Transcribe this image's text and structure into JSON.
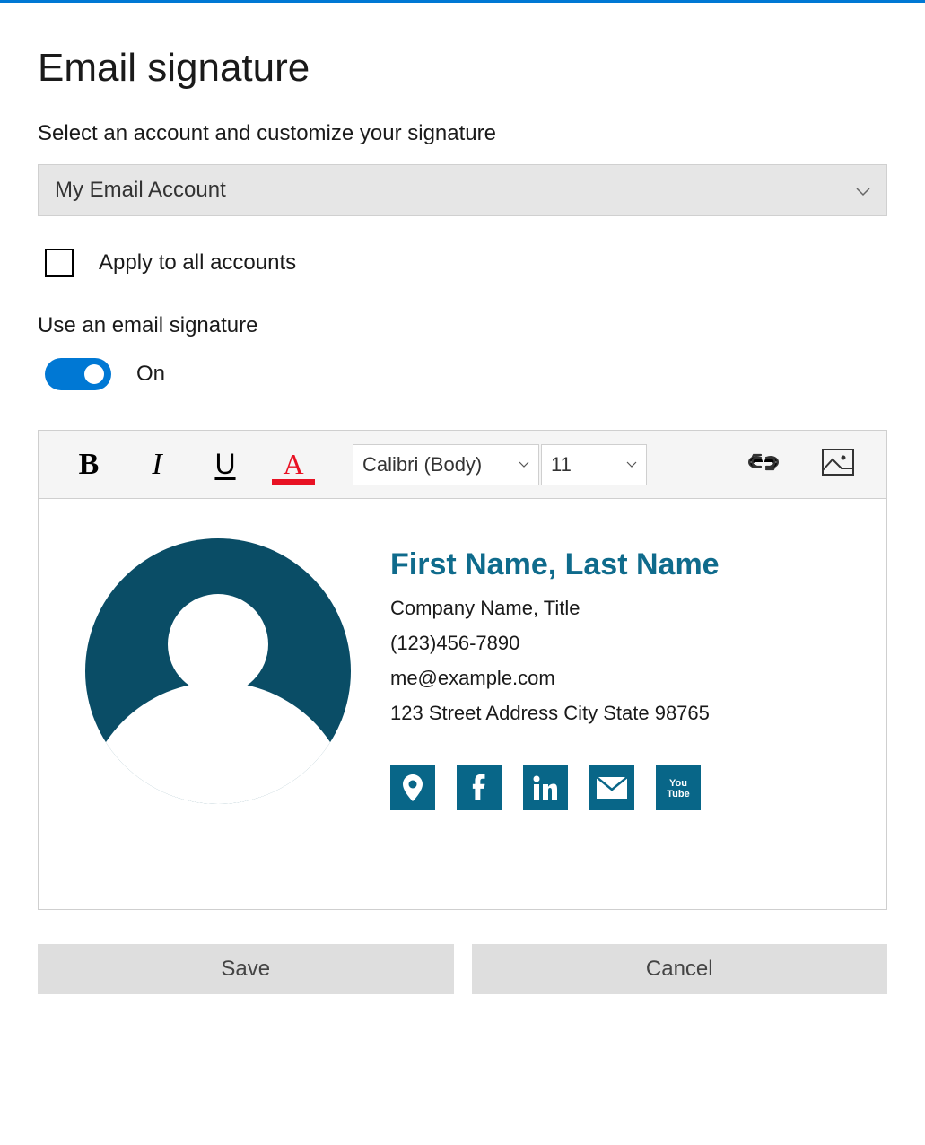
{
  "title": "Email signature",
  "subtitle": "Select an account and customize your signature",
  "accountDropdown": {
    "selected": "My Email Account"
  },
  "applyAll": {
    "label": "Apply to all accounts",
    "checked": false
  },
  "useSignature": {
    "label": "Use an email signature",
    "toggleState": "On"
  },
  "toolbar": {
    "fontName": "Calibri (Body)",
    "fontSize": "11"
  },
  "signature": {
    "name": "First Name, Last Name",
    "companyTitle": "Company Name, Title",
    "phone": "(123)456-7890",
    "email": "me@example.com",
    "address": "123 Street Address City State 98765"
  },
  "buttons": {
    "save": "Save",
    "cancel": "Cancel"
  },
  "colors": {
    "accent": "#0078d4",
    "sigTeal": "#086688",
    "fontColorRed": "#e81123"
  }
}
